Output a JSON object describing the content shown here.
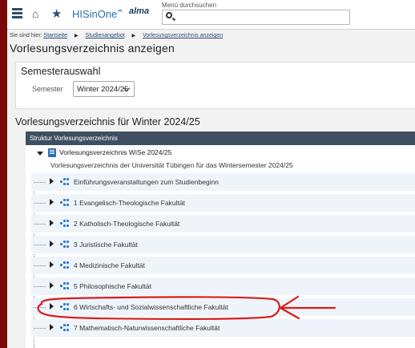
{
  "header": {
    "logo_text": "HISinOne",
    "logo_dots": "▪▪",
    "logo_alma": "alma",
    "search_label": "Menü durchsuchen",
    "search_value": ""
  },
  "breadcrumb": {
    "prefix": "Sie sind hier:",
    "items": [
      "Startseite",
      "Studienangebot",
      "Vorlesungsverzeichnis anzeigen"
    ]
  },
  "page": {
    "title": "Vorlesungsverzeichnis anzeigen"
  },
  "semester": {
    "heading": "Semesterauswahl",
    "label": "Semester",
    "selected": "Winter 2024/25"
  },
  "list": {
    "heading": "Vorlesungsverzeichnis für Winter 2024/25",
    "table_header": "Struktur Vorlesungsverzeichnis",
    "root_label": "Vorlesungsverzeichnis WiSe 2024/25",
    "root_description": "Vorlesungsverzeichnis der Universität Tübingen für das Wintersemester 2024/25",
    "items": [
      "Einführungsveranstaltungen zum Studienbeginn",
      "1 Evangelisch-Theologische Fakultät",
      "2 Katholisch-Theologische Fakultät",
      "3 Juristische Fakultät",
      "4 Medizinische Fakultät",
      "5 Philosophische Fakultät",
      "6 Wirtschafts- und Sozialwissenschaftliche Fakultät",
      "7 Mathematisch-Naturwissenschaftliche Fakultät"
    ]
  },
  "colors": {
    "frame": "#7a0a0a",
    "header_bar": "#3d4f60",
    "item_bg": "#eef4fa",
    "annotation": "#d81d1d",
    "icon_blue": "#2a7cc7"
  }
}
